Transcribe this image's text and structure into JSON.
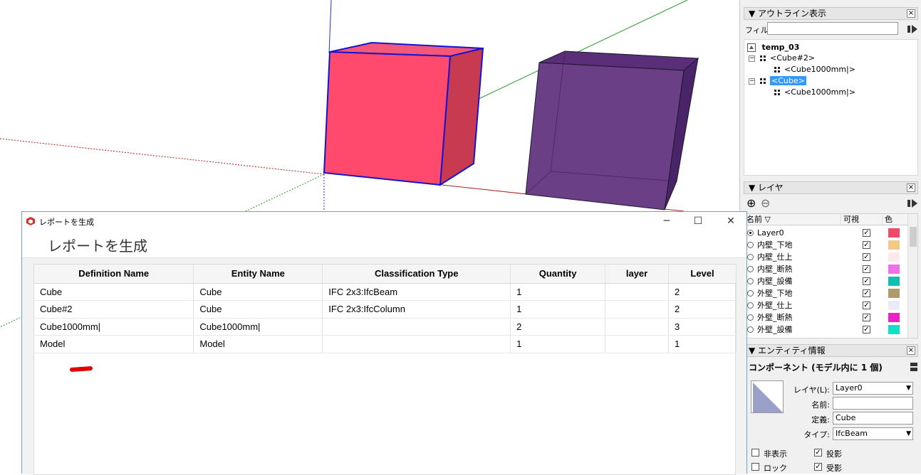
{
  "outliner": {
    "title": "▼ アウトライン表示",
    "filter_label": "フィル",
    "filter_value": "",
    "root": "temp_03",
    "items": [
      {
        "label": "<Cube#2>",
        "child": "<Cube1000mm|>"
      },
      {
        "label": "<Cube>",
        "child": "<Cube1000mm|>",
        "selected": true
      }
    ]
  },
  "layers": {
    "title": "▼ レイヤ",
    "add_symbol": "⊕",
    "remove_symbol": "⊖",
    "columns": {
      "name": "名前",
      "visible": "可視",
      "color": "色"
    },
    "rows": [
      {
        "name": "Layer0",
        "active": true,
        "visible": true,
        "color": "#f04a6a"
      },
      {
        "name": "内壁_下地",
        "active": false,
        "visible": true,
        "color": "#f5c88a"
      },
      {
        "name": "内壁_仕上",
        "active": false,
        "visible": true,
        "color": "#fde8ec"
      },
      {
        "name": "内壁_断熱",
        "active": false,
        "visible": true,
        "color": "#f070e8"
      },
      {
        "name": "内壁_設備",
        "active": false,
        "visible": true,
        "color": "#10c0b0"
      },
      {
        "name": "外壁_下地",
        "active": false,
        "visible": true,
        "color": "#b09a6a"
      },
      {
        "name": "外壁_仕上",
        "active": false,
        "visible": true,
        "color": "#ecebf5"
      },
      {
        "name": "外壁_断熱",
        "active": false,
        "visible": true,
        "color": "#f020c8"
      },
      {
        "name": "外壁_設備",
        "active": false,
        "visible": true,
        "color": "#10e0c8"
      }
    ]
  },
  "entity_info": {
    "title": "▼ エンティティ情報",
    "summary": "コンポーネント (モデル内に 1 個)",
    "layer_label": "レイヤ(L):",
    "layer_value": "Layer0",
    "name_label": "名前:",
    "name_value": "",
    "definition_label": "定義:",
    "definition_value": "Cube",
    "type_label": "タイプ:",
    "type_value": "IfcBeam",
    "hidden_label": "非表示",
    "lock_label": "ロック",
    "cast_shadows_label": "投影",
    "receive_shadows_label": "受影",
    "hidden": false,
    "lock": false,
    "cast_shadows": true,
    "receive_shadows": true
  },
  "dialog": {
    "title": "レポートを生成",
    "heading": "レポートを生成",
    "minimize": "─",
    "maximize": "☐",
    "close": "✕",
    "columns": [
      "Definition Name",
      "Entity Name",
      "Classification Type",
      "Quantity",
      "layer",
      "Level"
    ],
    "rows": [
      [
        "Cube",
        "Cube",
        "IFC 2x3:IfcBeam",
        "1",
        "",
        "2"
      ],
      [
        "Cube#2",
        "Cube",
        "IFC 2x3:IfcColumn",
        "1",
        "",
        "2"
      ],
      [
        "Cube1000mm|",
        "Cube1000mm|",
        "",
        "2",
        "",
        "3"
      ],
      [
        "Model",
        "Model",
        "",
        "1",
        "",
        "1"
      ]
    ]
  },
  "colors": {
    "pink_cube": "#f04a6a",
    "purple_cube": "#6a3f86",
    "selection_blue": "#3399ff"
  }
}
